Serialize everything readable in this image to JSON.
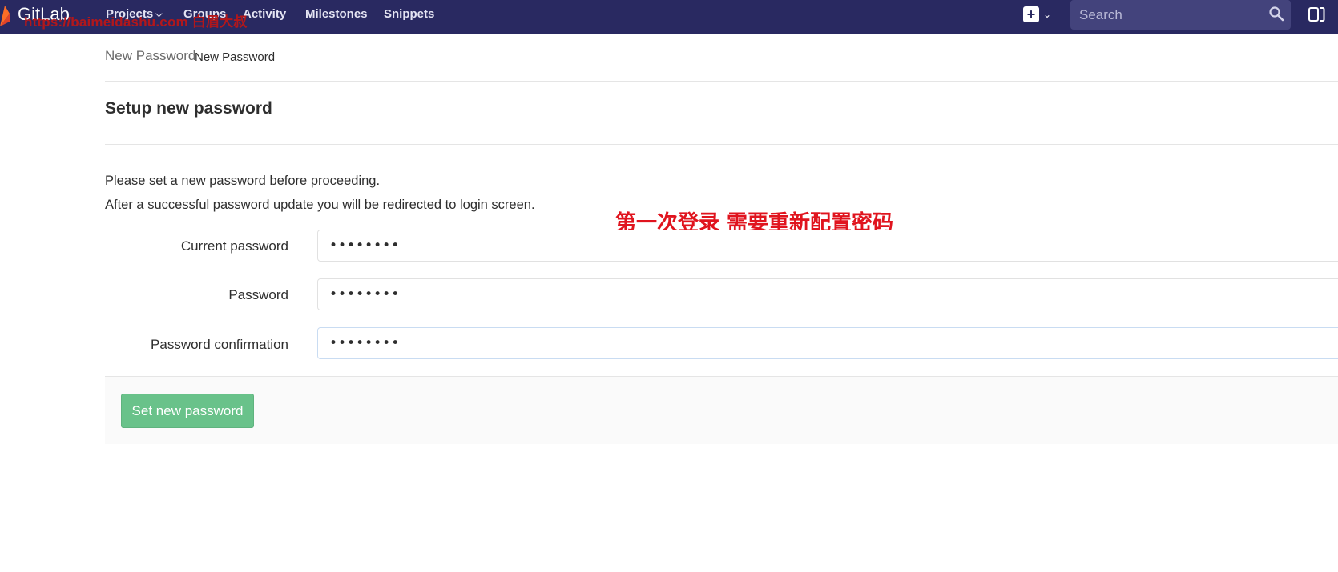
{
  "navbar": {
    "brand": "GitLab",
    "items": [
      {
        "label": "Projects"
      },
      {
        "label": "Groups"
      },
      {
        "label": "Activity"
      },
      {
        "label": "Milestones"
      },
      {
        "label": "Snippets"
      }
    ],
    "watermark": "https://baimeidashu.com 白眉大叔",
    "search_placeholder": "Search",
    "icons": [
      "gitlab-logo",
      "plus-icon",
      "chevron-down-icon",
      "search-icon",
      "sidebar-toggle-icon"
    ]
  },
  "breadcrumb": {
    "parent": "New Password",
    "current": "New Password"
  },
  "page": {
    "title": "Setup new password",
    "info_line_1": "Please set a new password before proceeding.",
    "info_line_2": "After a successful password update you will be redirected to login screen.",
    "annotation": "第一次登录 需要重新配置密码"
  },
  "form": {
    "fields": [
      {
        "label": "Current password",
        "value": "••••••••"
      },
      {
        "label": "Password",
        "value": "••••••••"
      },
      {
        "label": "Password confirmation",
        "value": "••••••••"
      }
    ],
    "submit_label": "Set new password"
  },
  "colors": {
    "navbar_bg": "#292961",
    "submit_bg": "#69c28a",
    "annotation": "#e0141e"
  }
}
